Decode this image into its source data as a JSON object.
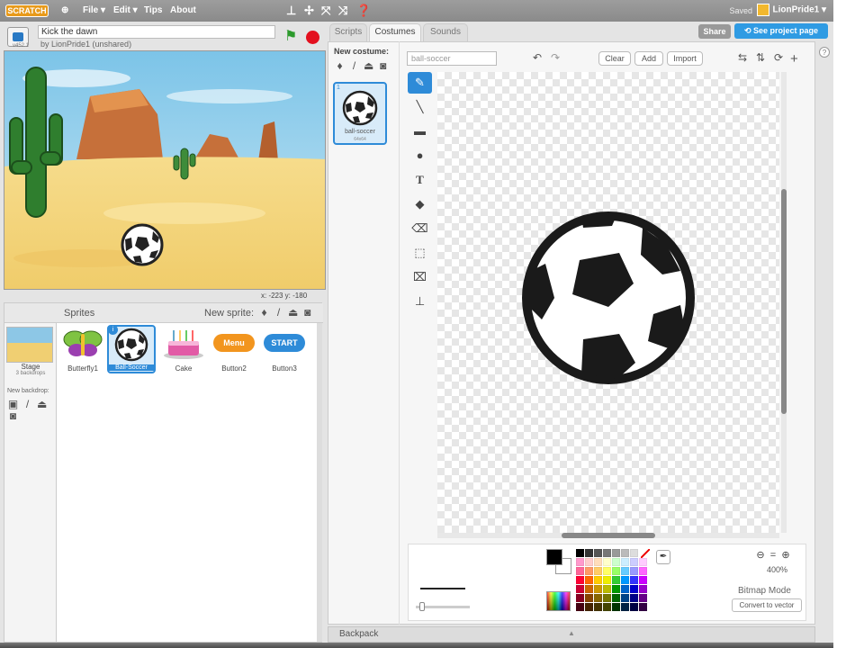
{
  "menubar": {
    "logo": "SCRATCH",
    "file": "File ▾",
    "edit": "Edit ▾",
    "tips": "Tips",
    "about": "About",
    "saved": "Saved",
    "user": "LionPride1 ▾"
  },
  "project": {
    "title": "Kick the dawn",
    "byline": "by LionPride1 (unshared)",
    "version": "v452.1"
  },
  "stage": {
    "coords": "x: -223  y: -180"
  },
  "sprites_panel": {
    "label": "Sprites",
    "new_sprite": "New sprite:",
    "stage_label": "Stage",
    "stage_sub": "3 backdrops",
    "new_backdrop": "New backdrop:",
    "items": [
      {
        "name": "Butterfly1"
      },
      {
        "name": "Ball-Soccer",
        "selected": true
      },
      {
        "name": "Cake"
      },
      {
        "name": "Button2",
        "text": "Menu",
        "color": "#f2951e"
      },
      {
        "name": "Button3",
        "text": "START",
        "color": "#2e8bd8"
      }
    ]
  },
  "tabs": [
    "Scripts",
    "Costumes",
    "Sounds"
  ],
  "header_buttons": {
    "share": "Share",
    "see_project": "See project page"
  },
  "costumes": {
    "new_costume": "New costume:",
    "items": [
      {
        "num": "1",
        "name": "ball-soccer",
        "size": "64x64"
      }
    ]
  },
  "paint": {
    "costume_name": "ball-soccer",
    "clear": "Clear",
    "add": "Add",
    "import": "Import",
    "zoom": "400%",
    "mode": "Bitmap Mode",
    "convert": "Convert to vector",
    "fill_color": "#000000"
  },
  "backpack": {
    "label": "Backpack"
  },
  "colors": {
    "accent": "#2e8bd8",
    "menubar": "#949494"
  }
}
